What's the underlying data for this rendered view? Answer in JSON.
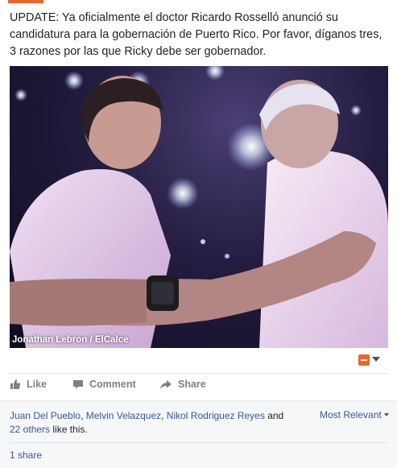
{
  "post": {
    "text": "UPDATE: Ya oficialmente el doctor Ricardo Rosselló anunció su candidatura para la gobernación de Puerto Rico. Por favor, díganos tres, 3 razones por las que Ricky debe ser gobernador.",
    "photo_credit": "Jonathan Lebron / ElCalce",
    "accent_color": "#e8662c"
  },
  "actions": {
    "like": "Like",
    "comment": "Comment",
    "share": "Share",
    "like_icon": "thumbs-up-icon",
    "comment_icon": "comment-bubble-icon",
    "share_icon": "share-arrow-icon"
  },
  "social": {
    "liker1": "Juan Del Pueblo",
    "sep1": ", ",
    "liker2": "Melvin Velazquez",
    "sep2": ", ",
    "liker3": "Nikol Rodriguez Reyes",
    "and": " and",
    "others": "22 others",
    "like_this": " like this.",
    "sort_label": "Most Relevant",
    "shares": "1 share",
    "link_color": "#365899"
  }
}
